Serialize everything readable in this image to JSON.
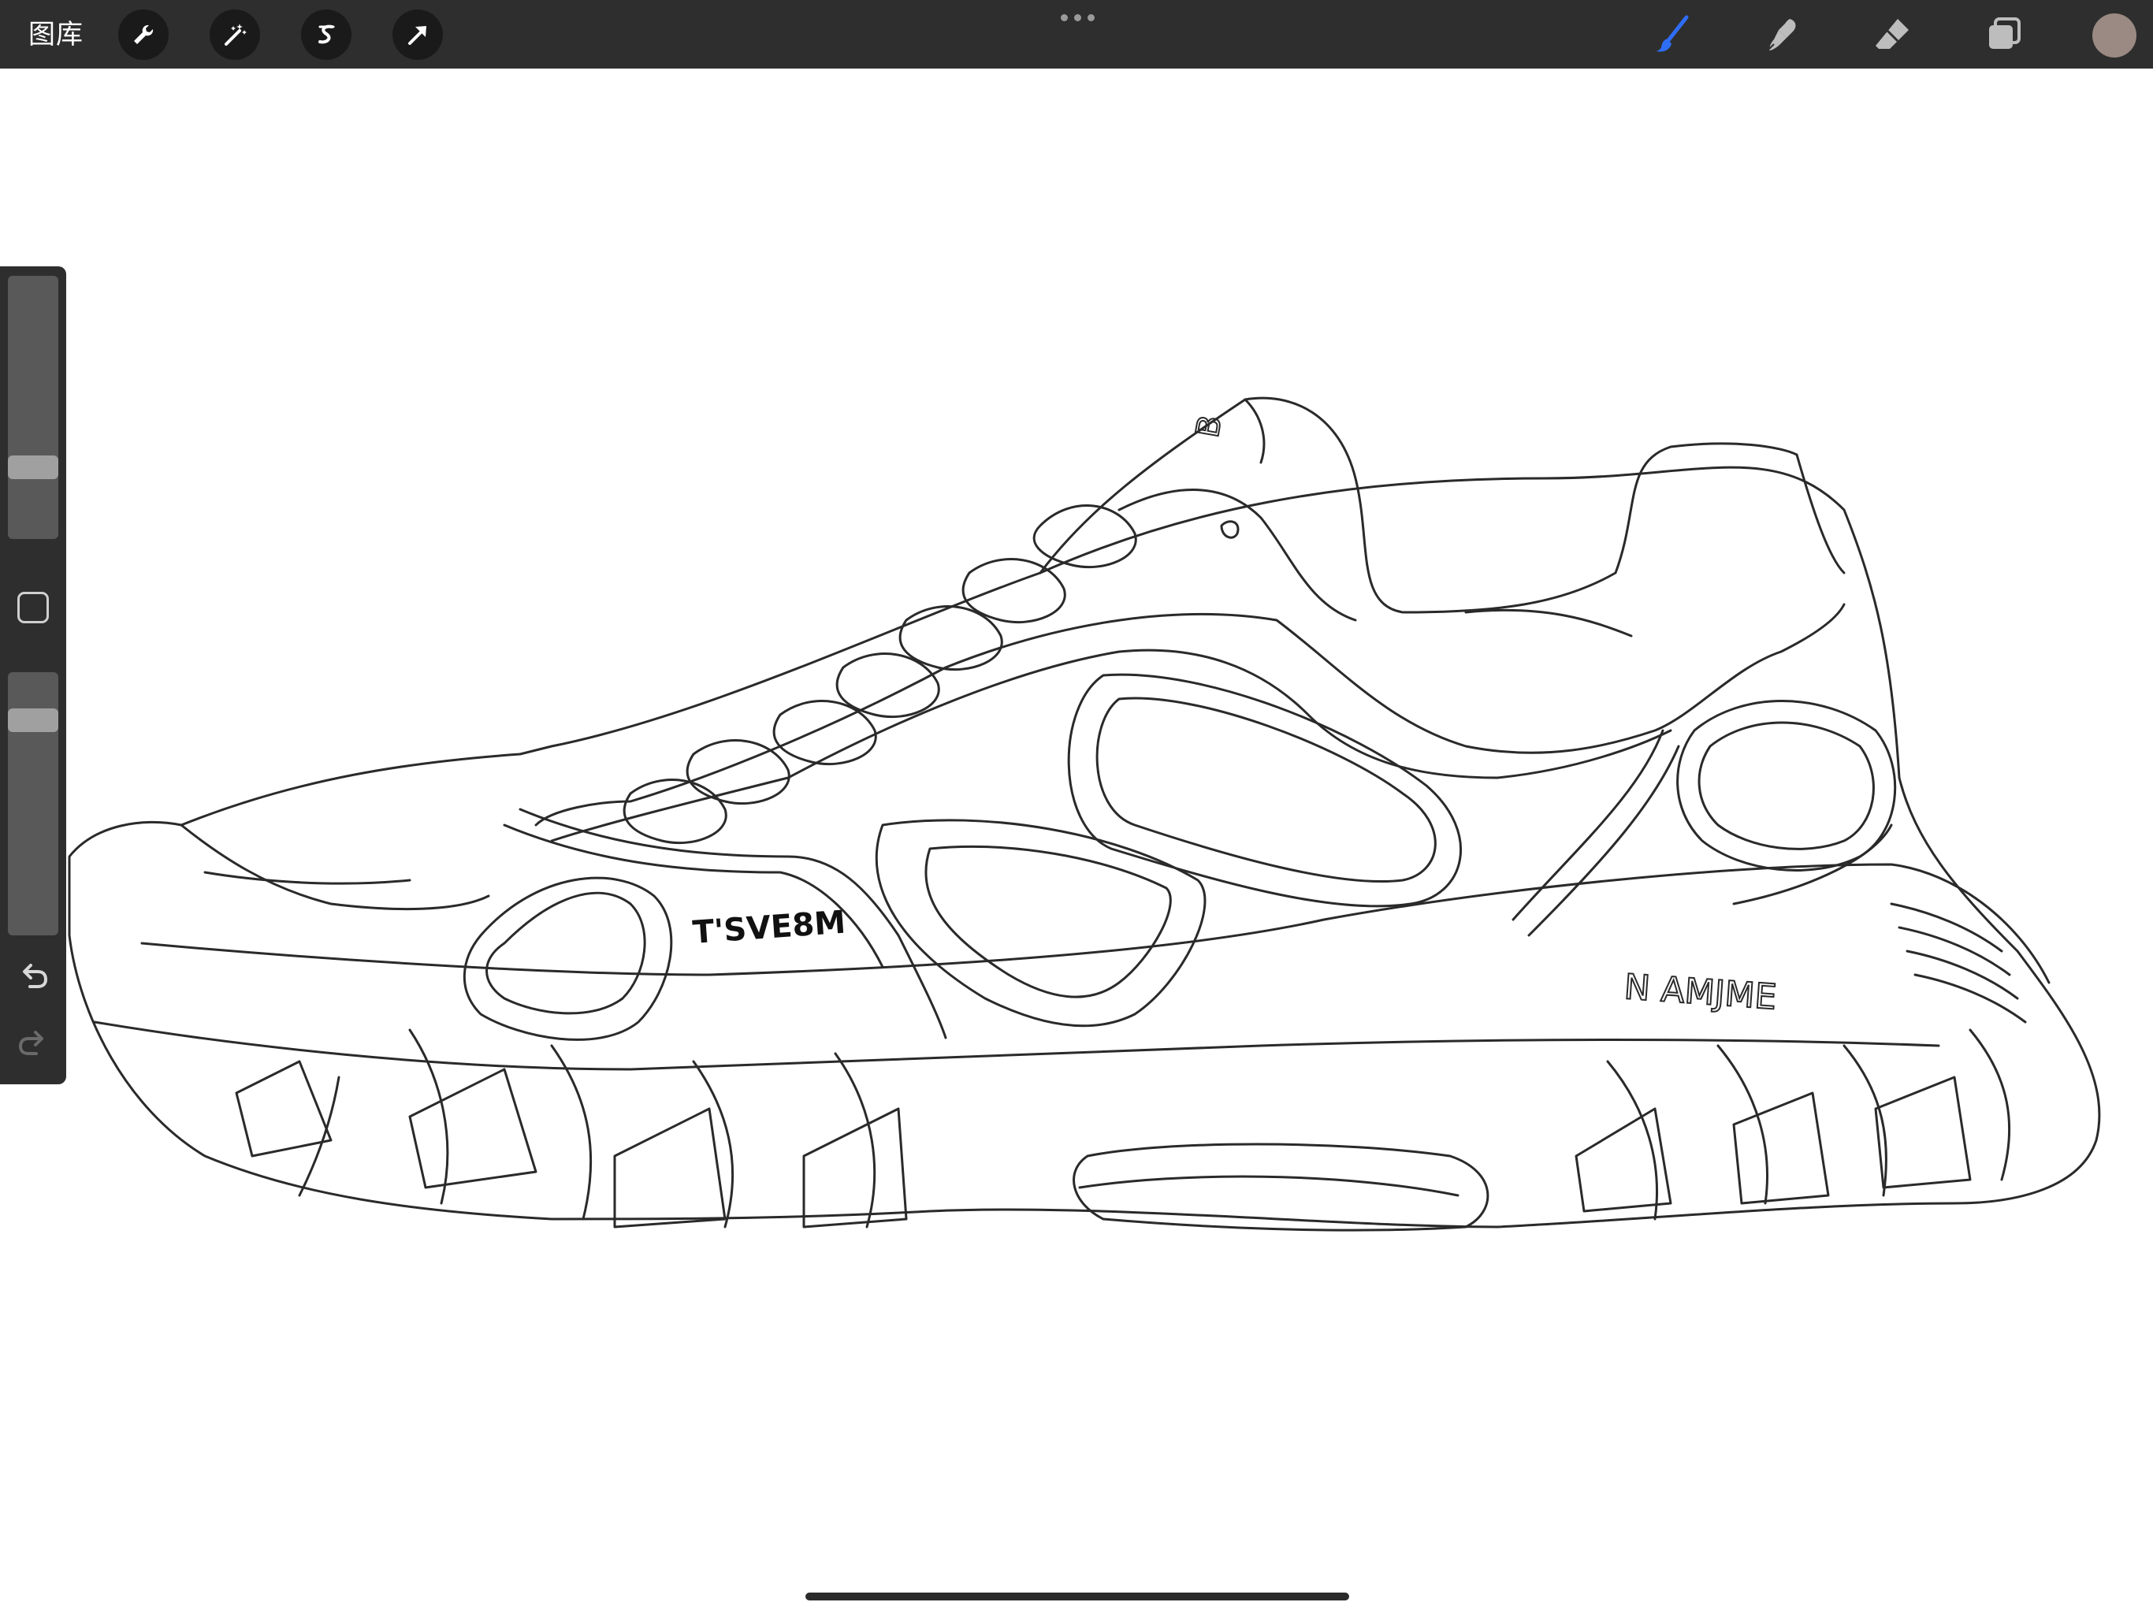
{
  "toolbar": {
    "gallery_label": "图库",
    "left_tools": [
      "wrench-icon",
      "magic-wand-icon",
      "selection-icon",
      "transform-arrow-icon"
    ],
    "right_tools": [
      "brush-icon",
      "smudge-icon",
      "eraser-icon",
      "layers-icon"
    ],
    "active_tool": "brush",
    "accent_color": "#2e6df6",
    "current_color": "#9a8a83"
  },
  "sidebar": {
    "brush_size": 0.25,
    "opacity": 0.85,
    "icons": [
      "modify-square-icon",
      "undo-icon",
      "redo-icon"
    ]
  },
  "canvas": {
    "heel_tab_text": "B",
    "side_logo_text": "T'SVE8M",
    "sole_logo_text": "N AMJME",
    "background": "#ffffff",
    "stroke_color": "#2a2a2a"
  }
}
